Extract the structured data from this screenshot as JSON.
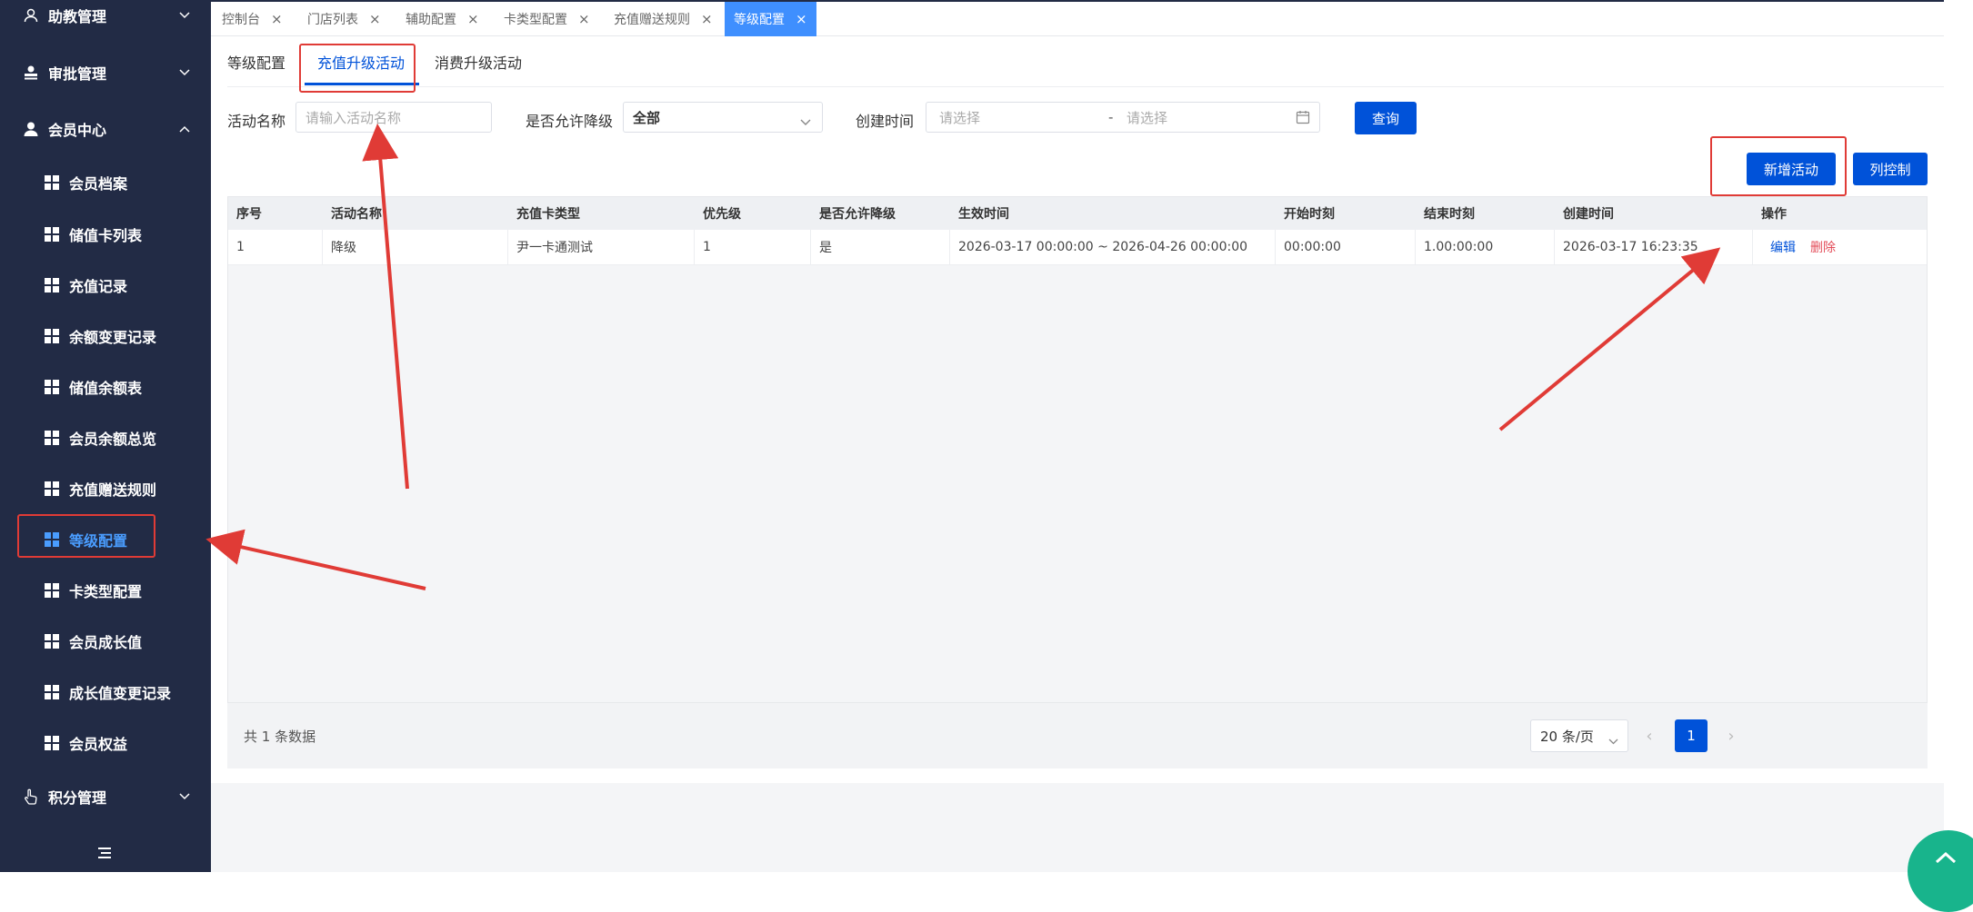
{
  "sidebar": {
    "groups": [
      {
        "label": "助教管理",
        "icon": "user-outline-icon",
        "expanded": false
      },
      {
        "label": "审批管理",
        "icon": "approve-user-icon",
        "expanded": false
      },
      {
        "label": "会员中心",
        "icon": "user-filled-icon",
        "expanded": true
      },
      {
        "label": "积分管理",
        "icon": "hand-point-icon",
        "expanded": false
      }
    ],
    "items": [
      {
        "label": "会员档案"
      },
      {
        "label": "储值卡列表"
      },
      {
        "label": "充值记录"
      },
      {
        "label": "余额变更记录"
      },
      {
        "label": "储值余额表"
      },
      {
        "label": "会员余额总览"
      },
      {
        "label": "充值赠送规则"
      },
      {
        "label": "等级配置"
      },
      {
        "label": "卡类型配置"
      },
      {
        "label": "会员成长值"
      },
      {
        "label": "成长值变更记录"
      },
      {
        "label": "会员权益"
      }
    ],
    "active_item": "等级配置",
    "accent_color": "#4a9dff",
    "background_color": "#222b45"
  },
  "tabs": [
    {
      "label": "控制台",
      "close": "×"
    },
    {
      "label": "门店列表",
      "close": "×"
    },
    {
      "label": "辅助配置",
      "close": "×"
    },
    {
      "label": "卡类型配置",
      "close": "×"
    },
    {
      "label": "充值赠送规则",
      "close": "×"
    },
    {
      "label": "等级配置",
      "close": "×",
      "active": true
    }
  ],
  "subtabs": [
    {
      "label": "等级配置"
    },
    {
      "label": "充值升级活动",
      "active": true
    },
    {
      "label": "消费升级活动"
    }
  ],
  "filters": {
    "name_label": "活动名称",
    "name_placeholder": "请输入活动名称",
    "downgrade_label": "是否允许降级",
    "downgrade_value": "全部",
    "created_label": "创建时间",
    "date_start_placeholder": "请选择",
    "date_separator": "-",
    "date_end_placeholder": "请选择",
    "query_button": "查询"
  },
  "actions": {
    "add_button": "新增活动",
    "columns_button": "列控制"
  },
  "table": {
    "headers": [
      "序号",
      "活动名称",
      "充值卡类型",
      "优先级",
      "是否允许降级",
      "生效时间",
      "开始时刻",
      "结束时刻",
      "创建时间",
      "操作"
    ],
    "rows": [
      {
        "cells": [
          "1",
          "降级",
          "尹一卡通测试",
          "1",
          "是",
          "2026-03-17 00:00:00 ~ 2026-04-26 00:00:00",
          "00:00:00",
          "1.00:00:00",
          "2026-03-17 16:23:35"
        ],
        "edit": "编辑",
        "delete": "删除"
      }
    ]
  },
  "pagination": {
    "total_text": "共 1 条数据",
    "page_size": "20 条/页",
    "current_page": "1",
    "prev": "‹",
    "next": "›"
  },
  "colors": {
    "primary": "#0052d9",
    "tab_active": "#3f8ffe",
    "danger": "#e34d59",
    "annotation": "#e03b36"
  }
}
